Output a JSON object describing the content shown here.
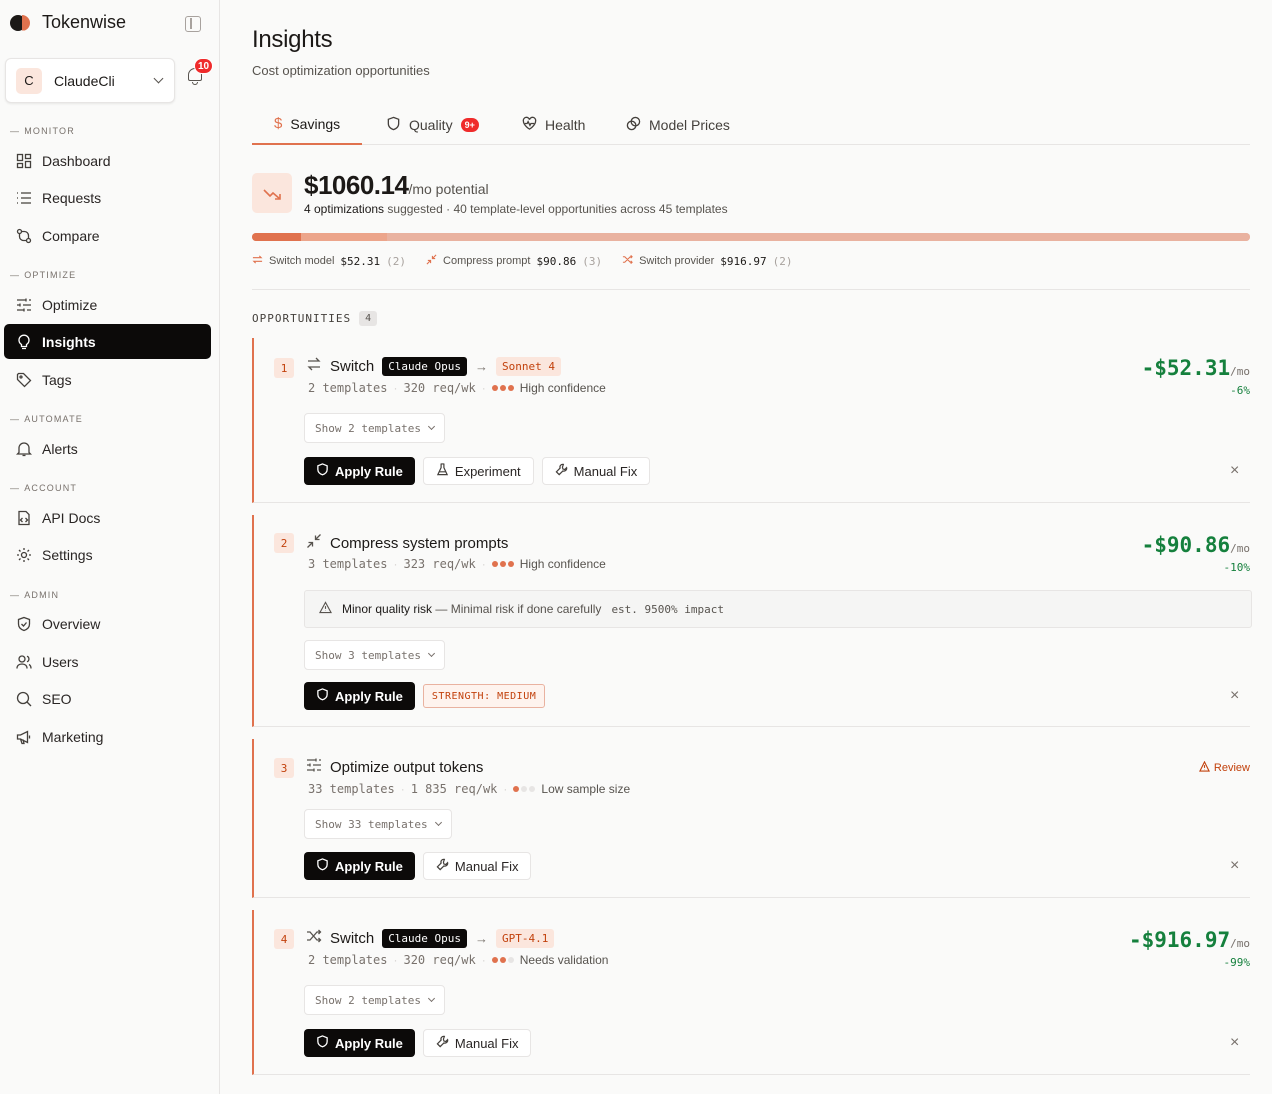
{
  "brand": {
    "name": "Tokenwise"
  },
  "account": {
    "initial": "C",
    "name": "ClaudeCli"
  },
  "notifications": {
    "count": "10"
  },
  "nav": {
    "sections": {
      "monitor": "MONITOR",
      "optimize": "OPTIMIZE",
      "automate": "AUTOMATE",
      "account": "ACCOUNT",
      "admin": "ADMIN"
    },
    "items": {
      "dashboard": "Dashboard",
      "requests": "Requests",
      "compare": "Compare",
      "optimize": "Optimize",
      "insights": "Insights",
      "tags": "Tags",
      "alerts": "Alerts",
      "api_docs": "API Docs",
      "settings": "Settings",
      "overview": "Overview",
      "users": "Users",
      "seo": "SEO",
      "marketing": "Marketing"
    },
    "active": "insights"
  },
  "page": {
    "title": "Insights",
    "subtitle": "Cost optimization opportunities"
  },
  "tabs": {
    "savings": "Savings",
    "quality": "Quality",
    "quality_badge": "9+",
    "health": "Health",
    "model_prices": "Model Prices",
    "active": "savings"
  },
  "summary": {
    "amount": "$1060.14",
    "unit": "/mo potential",
    "count_text": "4 optimizations",
    "suggested_text": "suggested",
    "detail": "· 40 template-level opportunities across 45 templates",
    "bar": [
      {
        "label": "Switch model",
        "value": 52.31,
        "color": "#e0724e"
      },
      {
        "label": "Compress prompt",
        "value": 90.86,
        "color": "#eca58b"
      },
      {
        "label": "Switch provider",
        "value": 916.97,
        "color": "#e9b2a0"
      }
    ],
    "breakdown": [
      {
        "label": "Switch model",
        "amount": "$52.31",
        "count": "(2)"
      },
      {
        "label": "Compress prompt",
        "amount": "$90.86",
        "count": "(3)"
      },
      {
        "label": "Switch provider",
        "amount": "$916.97",
        "count": "(2)"
      }
    ]
  },
  "opportunities": {
    "heading": "OPPORTUNITIES",
    "count": "4",
    "cards": [
      {
        "num": "1",
        "title": "Switch",
        "from_model": "Claude Opus",
        "arrow": "→",
        "to_model": "Sonnet 4",
        "templates": "2 templates",
        "reqs": "320 req/wk",
        "confidence": "High confidence",
        "show": "Show 2 templates",
        "apply": "Apply Rule",
        "experiment": "Experiment",
        "manual": "Manual Fix",
        "amount": "-$52.31",
        "amount_unit": "/mo",
        "pct": "-6%"
      },
      {
        "num": "2",
        "title": "Compress system prompts",
        "templates": "3 templates",
        "reqs": "323 req/wk",
        "confidence": "High confidence",
        "risk_label": "Minor quality risk",
        "risk_text": "— Minimal risk if done carefully",
        "risk_impact": "est. 9500% impact",
        "show": "Show 3 templates",
        "apply": "Apply Rule",
        "strength": "STRENGTH: MEDIUM",
        "amount": "-$90.86",
        "amount_unit": "/mo",
        "pct": "-10%"
      },
      {
        "num": "3",
        "title": "Optimize output tokens",
        "templates": "33 templates",
        "reqs": "1 835 req/wk",
        "confidence": "Low sample size",
        "show": "Show 33 templates",
        "apply": "Apply Rule",
        "manual": "Manual Fix",
        "review": "Review"
      },
      {
        "num": "4",
        "title": "Switch",
        "from_model": "Claude Opus",
        "arrow": "→",
        "to_model": "GPT-4.1",
        "templates": "2 templates",
        "reqs": "320 req/wk",
        "confidence": "Needs validation",
        "show": "Show 2 templates",
        "apply": "Apply Rule",
        "manual": "Manual Fix",
        "amount": "-$916.97",
        "amount_unit": "/mo",
        "pct": "-99%"
      }
    ]
  },
  "colors": {
    "accent": "#e0724e",
    "saving": "#15803d",
    "danger": "#ef2b2b"
  }
}
